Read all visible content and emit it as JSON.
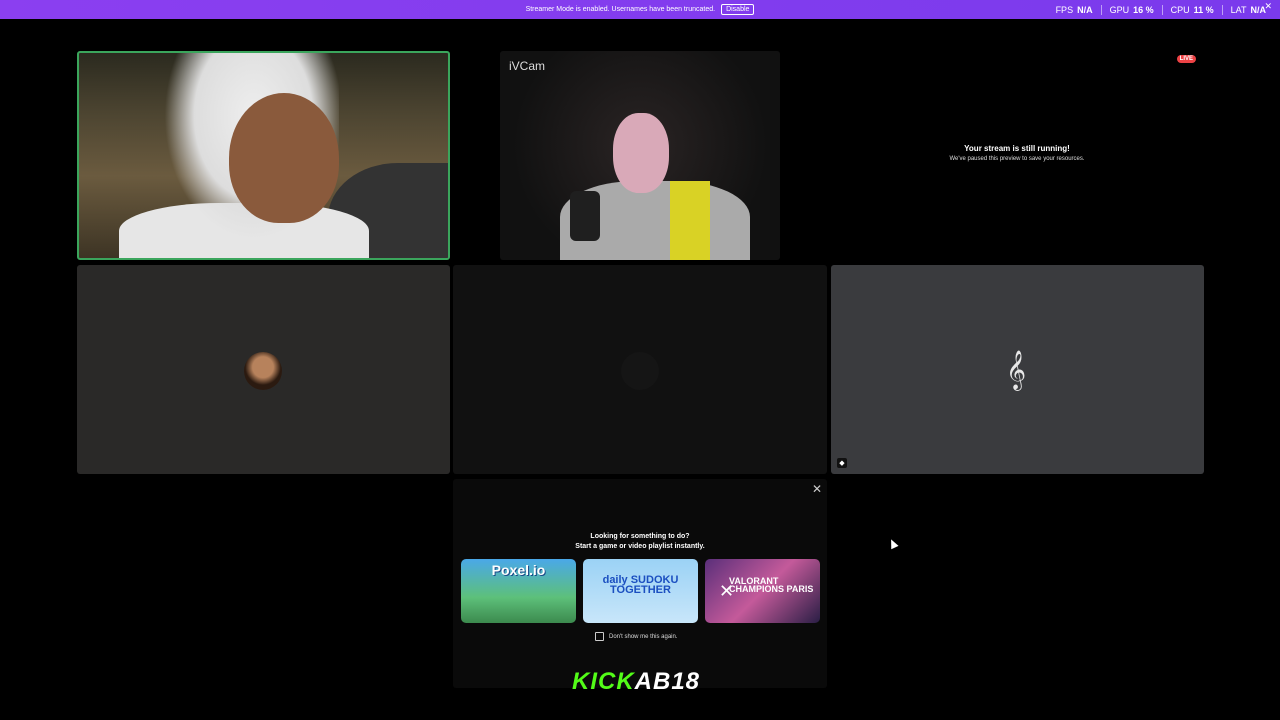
{
  "banner": {
    "message": "Streamer Mode is enabled. Usernames have been truncated.",
    "disable_label": "Disable"
  },
  "stats": {
    "fps_label": "FPS",
    "fps_value": "N/A",
    "gpu_label": "GPU",
    "gpu_value": "16 %",
    "cpu_label": "CPU",
    "cpu_value": "11 %",
    "lat_label": "LAT",
    "lat_value": "N/A"
  },
  "tiles": {
    "ivcam_label": "iVCam",
    "live_badge": "LIVE",
    "stream_title": "Your stream is still running!",
    "stream_sub": "We've paused this preview to save your resources."
  },
  "activity_panel": {
    "title_line1": "Looking for something to do?",
    "title_line2": "Start a game or video playlist instantly.",
    "cards": [
      {
        "label": "Poxel.io"
      },
      {
        "label": "daily SUDOKU TOGETHER"
      },
      {
        "label": "VALORANT CHAMPIONS PARIS"
      }
    ],
    "dont_show": "Don't show me this again."
  },
  "overlay": {
    "kick_part1": "KICK",
    "kick_part2": "AB18"
  },
  "colors": {
    "banner": "#7c3aed",
    "speaking_border": "#3ba55c",
    "live": "#ed4245",
    "kick_green": "#53fc18"
  }
}
